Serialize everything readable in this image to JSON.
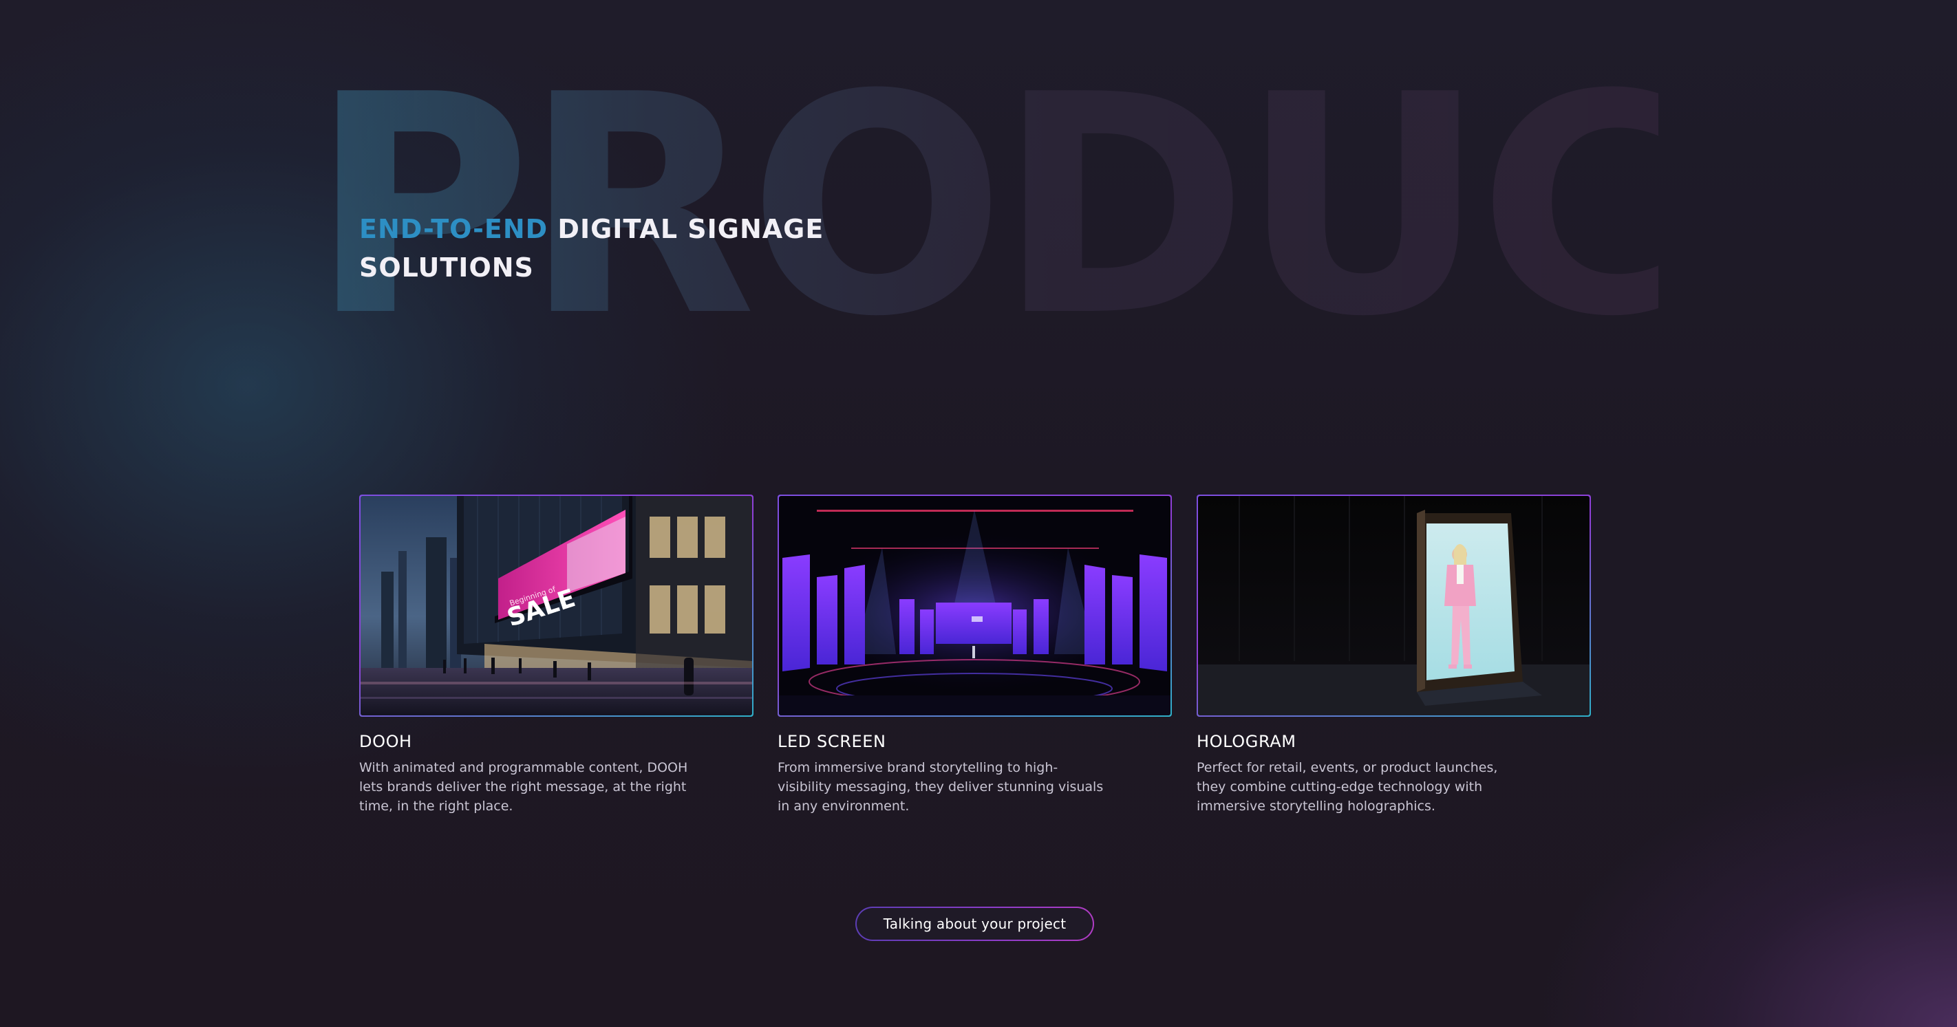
{
  "hero": {
    "watermark": "PRODUCT",
    "headline_accent": "END-TO-END",
    "headline_rest": " DIGITAL SIGNAGE",
    "headline_line2": "SOLUTIONS"
  },
  "cards": [
    {
      "title": "DOOH",
      "description": "With animated and programmable content, DOOH lets brands deliver the right message, at the right time, in the right place.",
      "image_alt": "Night city street with large LED billboard",
      "image_text_1": "Beginning of",
      "image_text_2": "SALE"
    },
    {
      "title": "LED SCREEN",
      "description": "From immersive brand storytelling to high-visibility messaging, they deliver stunning visuals in any environment.",
      "image_alt": "Event stage with purple LED screens"
    },
    {
      "title": "HOLOGRAM",
      "description": "Perfect for retail, events, or product launches, they combine cutting-edge technology with immersive storytelling holographics.",
      "image_alt": "Hologram display box with a woman in pink suit"
    }
  ],
  "cta": {
    "label": "Talking about your project"
  },
  "colors": {
    "accent_blue": "#2d8fc4",
    "border_purple": "#8f3fd6",
    "border_cyan": "#2fb0c8",
    "background": "#1d1824"
  }
}
